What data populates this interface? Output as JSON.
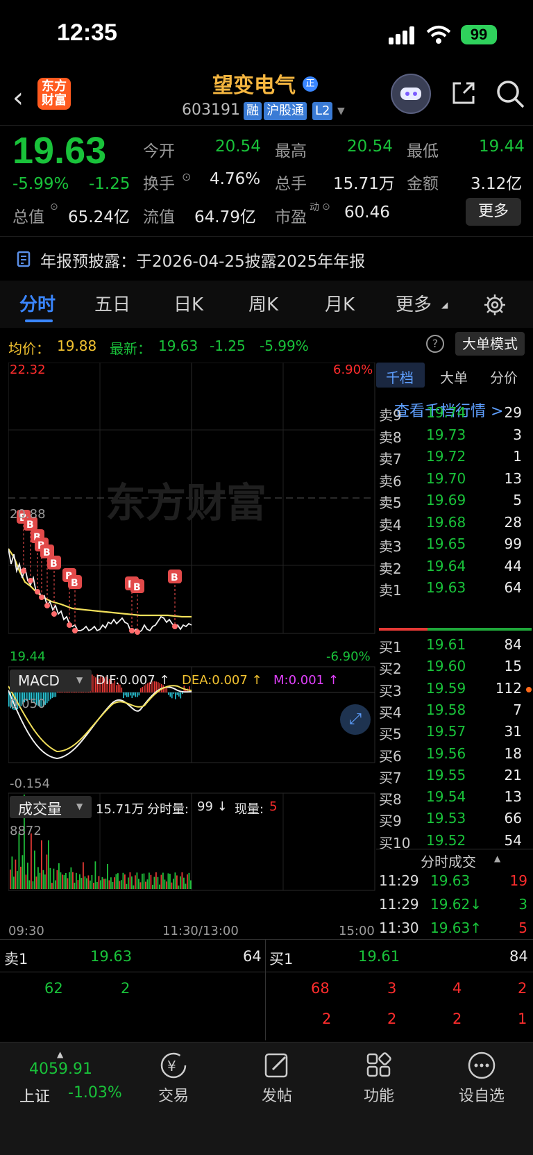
{
  "status": {
    "time": "12:35",
    "battery": "99"
  },
  "header": {
    "logo": "东方财富",
    "name": "望变电气",
    "name_badge": "正",
    "code": "603191",
    "tags": [
      "融",
      "沪股通",
      "L2"
    ]
  },
  "quote": {
    "price": "19.63",
    "pct": "-5.99%",
    "chg": "-1.25",
    "open_label": "今开",
    "open": "20.54",
    "high_label": "最高",
    "high": "20.54",
    "low_label": "最低",
    "low": "19.44",
    "turnover_label": "换手",
    "turnover": "4.76%",
    "vol_label": "总手",
    "vol": "15.71万",
    "amount_label": "金额",
    "amount": "3.12亿",
    "mktcap_label": "总值",
    "mktcap": "65.24亿",
    "float_label": "流值",
    "float": "64.79亿",
    "pe_label": "市盈",
    "pe_sup": "动",
    "pe": "60.46",
    "more": "更多"
  },
  "notice": "年报预披露：于2026-04-25披露2025年年报",
  "tabs": [
    "分时",
    "五日",
    "日K",
    "周K",
    "月K",
    "更多"
  ],
  "info": {
    "avg_label": "均价：",
    "avg": "19.88",
    "latest_label": "最新：",
    "latest": "19.63",
    "chg": "-1.25",
    "pct": "-5.99%",
    "mode_btn": "大单模式"
  },
  "chart_labels": {
    "top": "22.32",
    "top_pct": "6.90%",
    "mid": "20.88",
    "bottom": "19.44",
    "bottom_pct": "-6.90%",
    "watermark": "东方财富",
    "macd_title": "MACD",
    "dif": "DIF:0.007 ↑",
    "dea": "DEA:0.007 ↑",
    "m": "M:0.001 ↑",
    "macd_top": "0.050",
    "macd_bottom": "-0.154",
    "vol_title": "成交量",
    "vol_total": "15.71万",
    "vol_tick_label": "分时量:",
    "vol_tick": "99 ↓",
    "vol_now_label": "现量:",
    "vol_now": "5",
    "vol_max": "8872",
    "x_start": "09:30",
    "x_mid": "11:30/13:00",
    "x_end": "15:00"
  },
  "depth": {
    "tabs": [
      "千档",
      "大单",
      "分价"
    ],
    "link": "查看千档行情 >",
    "sells": [
      {
        "label": "卖9",
        "price": "19.74",
        "vol": "29"
      },
      {
        "label": "卖8",
        "price": "19.73",
        "vol": "3"
      },
      {
        "label": "卖7",
        "price": "19.72",
        "vol": "1"
      },
      {
        "label": "卖6",
        "price": "19.70",
        "vol": "13"
      },
      {
        "label": "卖5",
        "price": "19.69",
        "vol": "5"
      },
      {
        "label": "卖4",
        "price": "19.68",
        "vol": "28"
      },
      {
        "label": "卖3",
        "price": "19.65",
        "vol": "99"
      },
      {
        "label": "卖2",
        "price": "19.64",
        "vol": "44"
      },
      {
        "label": "卖1",
        "price": "19.63",
        "vol": "64"
      }
    ],
    "buys": [
      {
        "label": "买1",
        "price": "19.61",
        "vol": "84"
      },
      {
        "label": "买2",
        "price": "19.60",
        "vol": "15"
      },
      {
        "label": "买3",
        "price": "19.59",
        "vol": "112"
      },
      {
        "label": "买4",
        "price": "19.58",
        "vol": "7"
      },
      {
        "label": "买5",
        "price": "19.57",
        "vol": "31"
      },
      {
        "label": "买6",
        "price": "19.56",
        "vol": "18"
      },
      {
        "label": "买7",
        "price": "19.55",
        "vol": "21"
      },
      {
        "label": "买8",
        "price": "19.54",
        "vol": "13"
      },
      {
        "label": "买9",
        "price": "19.53",
        "vol": "66"
      },
      {
        "label": "买10",
        "price": "19.52",
        "vol": "54"
      }
    ],
    "ticks_title": "分时成交",
    "ticks": [
      {
        "time": "11:29",
        "price": "19.63",
        "vol": "19"
      },
      {
        "time": "11:29",
        "price": "19.62↓",
        "vol": "3"
      },
      {
        "time": "11:30",
        "price": "19.63↑",
        "vol": "5"
      }
    ]
  },
  "bottom_quote": {
    "sell_label": "卖1",
    "sell_price": "19.63",
    "sell_vol": "64",
    "buy_label": "买1",
    "buy_price": "19.61",
    "buy_vol": "84",
    "sell_orders": [
      "62",
      "2"
    ],
    "buy_orders_row1": [
      "68",
      "3",
      "4",
      "2"
    ],
    "buy_orders_row2": [
      "2",
      "2",
      "2",
      "1"
    ]
  },
  "nav": {
    "index_value": "4059.91",
    "index_name": "上证",
    "index_pct": "-1.03%",
    "items": [
      "交易",
      "发帖",
      "功能",
      "设自选"
    ]
  },
  "colors": {
    "up": "#ff2d2d",
    "down": "#19c23a",
    "avg_line": "#f2e05a",
    "accent": "#3a86ff"
  }
}
